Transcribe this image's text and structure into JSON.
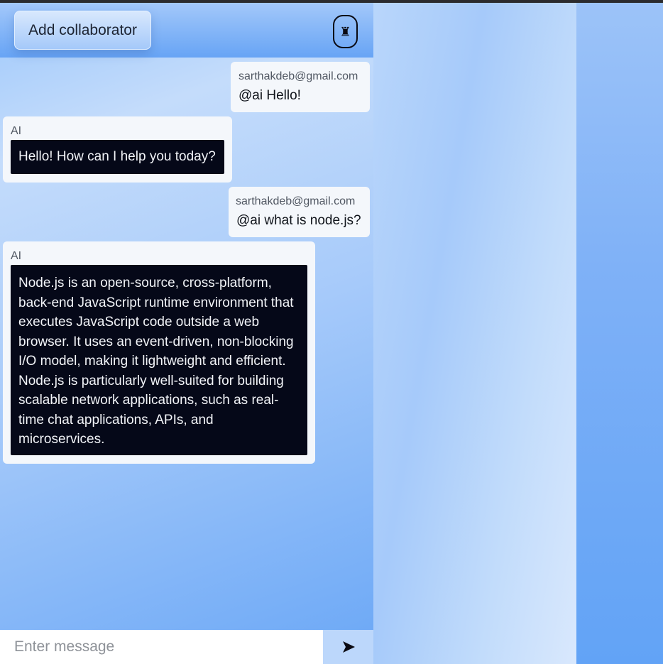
{
  "header": {
    "add_collaborator_label": "Add collaborator",
    "collaborators_icon": "rook-icon",
    "collaborators_glyph": "♜"
  },
  "messages": [
    {
      "role": "user",
      "sender": "sarthakdeb@gmail.com",
      "text": "@ai Hello!"
    },
    {
      "role": "ai",
      "sender": "AI",
      "text": "Hello! How can I help you today?"
    },
    {
      "role": "user",
      "sender": "sarthakdeb@gmail.com",
      "text": "@ai what is node.js?"
    },
    {
      "role": "ai",
      "sender": "AI",
      "text": "Node.js is an open-source, cross-platform, back-end JavaScript runtime environment that executes JavaScript code outside a web browser. It uses an event-driven, non-blocking I/O model, making it lightweight and efficient. Node.js is particularly well-suited for building scalable network applications, such as real-time chat applications, APIs, and microservices."
    }
  ],
  "composer": {
    "placeholder": "Enter message",
    "value": "",
    "send_icon": "send-icon"
  },
  "colors": {
    "ai_message_bg": "#050818",
    "bubble_bg": "#f4f7fb",
    "accent_blue": "#67a4f5"
  }
}
